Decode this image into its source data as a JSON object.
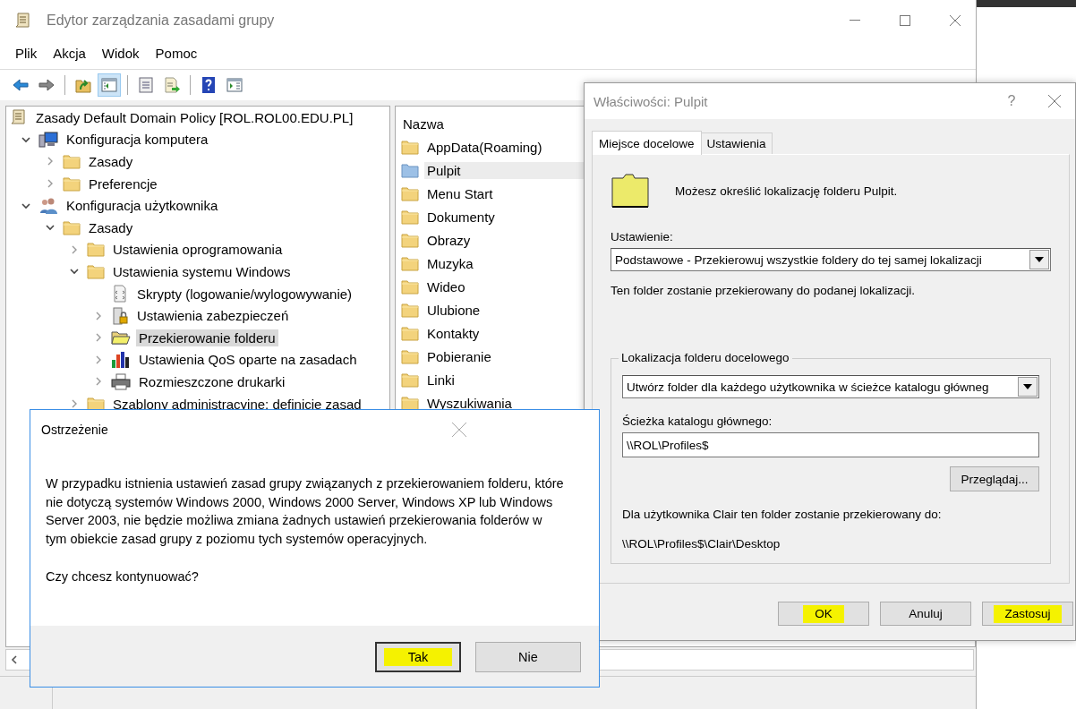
{
  "window": {
    "title": "Edytor zarządzania zasadami grupy"
  },
  "menu": [
    "Plik",
    "Akcja",
    "Widok",
    "Pomoc"
  ],
  "toolbar": [
    {
      "kind": "back",
      "pressed": false
    },
    {
      "kind": "forward",
      "pressed": false
    },
    {
      "kind": "separator"
    },
    {
      "kind": "up",
      "pressed": false
    },
    {
      "kind": "tree-toggle",
      "pressed": true
    },
    {
      "kind": "separator"
    },
    {
      "kind": "properties",
      "pressed": false
    },
    {
      "kind": "export",
      "pressed": false
    },
    {
      "kind": "separator"
    },
    {
      "kind": "help",
      "pressed": false
    },
    {
      "kind": "action-pane",
      "pressed": false
    }
  ],
  "tree": {
    "root": {
      "label": "Zasady Default Domain Policy [ROL.ROL00.EDU.PL]",
      "kind": "policy",
      "selected": false,
      "children": [
        {
          "label": "Konfiguracja komputera",
          "kind": "computer",
          "expandable": true,
          "expanded": true,
          "selected": false,
          "children": [
            {
              "label": "Zasady",
              "kind": "folder",
              "expandable": true,
              "expanded": false,
              "selected": false
            },
            {
              "label": "Preferencje",
              "kind": "folder",
              "expandable": true,
              "expanded": false,
              "selected": false
            }
          ]
        },
        {
          "label": "Konfiguracja użytkownika",
          "kind": "user",
          "expandable": true,
          "expanded": true,
          "selected": false,
          "children": [
            {
              "label": "Zasady",
              "kind": "folder",
              "expandable": true,
              "expanded": true,
              "selected": false,
              "children": [
                {
                  "label": "Ustawienia oprogramowania",
                  "kind": "folder",
                  "expandable": true,
                  "expanded": false,
                  "selected": false
                },
                {
                  "label": "Ustawienia systemu Windows",
                  "kind": "folder",
                  "expandable": true,
                  "expanded": true,
                  "selected": false,
                  "children": [
                    {
                      "label": "Skrypty (logowanie/wylogowywanie)",
                      "kind": "script",
                      "expandable": false,
                      "selected": false
                    },
                    {
                      "label": "Ustawienia zabezpieczeń",
                      "kind": "security",
                      "expandable": true,
                      "expanded": false,
                      "selected": false
                    },
                    {
                      "label": "Przekierowanie folderu",
                      "kind": "redirect",
                      "expandable": true,
                      "expanded": false,
                      "selected": true
                    },
                    {
                      "label": "Ustawienia QoS oparte na zasadach",
                      "kind": "qos",
                      "expandable": true,
                      "expanded": false,
                      "selected": false
                    },
                    {
                      "label": "Rozmieszczone drukarki",
                      "kind": "printer",
                      "expandable": true,
                      "expanded": false,
                      "selected": false
                    }
                  ]
                },
                {
                  "label": "Szablony administracyjne: definicje zasad",
                  "kind": "folder",
                  "expandable": true,
                  "expanded": false,
                  "selected": false
                }
              ]
            }
          ]
        }
      ]
    }
  },
  "list": {
    "header": "Nazwa",
    "items": [
      {
        "label": "AppData(Roaming)",
        "kind": "folder",
        "selected": false
      },
      {
        "label": "Pulpit",
        "kind": "redirected",
        "selected": true
      },
      {
        "label": "Menu Start",
        "kind": "folder",
        "selected": false
      },
      {
        "label": "Dokumenty",
        "kind": "folder",
        "selected": false
      },
      {
        "label": "Obrazy",
        "kind": "folder",
        "selected": false
      },
      {
        "label": "Muzyka",
        "kind": "folder",
        "selected": false
      },
      {
        "label": "Wideo",
        "kind": "folder",
        "selected": false
      },
      {
        "label": "Ulubione",
        "kind": "folder",
        "selected": false
      },
      {
        "label": "Kontakty",
        "kind": "folder",
        "selected": false
      },
      {
        "label": "Pobieranie",
        "kind": "folder",
        "selected": false
      },
      {
        "label": "Linki",
        "kind": "folder",
        "selected": false
      },
      {
        "label": "Wyszukiwania",
        "kind": "folder",
        "selected": false
      }
    ]
  },
  "properties": {
    "title": "Właściwości: Pulpit",
    "help": "?",
    "tabs": [
      {
        "label": "Miejsce docelowe",
        "selected": true
      },
      {
        "label": "Ustawienia",
        "selected": false
      }
    ],
    "intro": "Możesz określić lokalizację folderu Pulpit.",
    "setting_label": "Ustawienie:",
    "setting_value": "Podstawowe - Przekierowuj wszystkie foldery do tej samej lokalizacji",
    "setting_note": "Ten folder zostanie przekierowany do podanej lokalizacji.",
    "group": {
      "legend": "Lokalizacja folderu docelowego",
      "location_value": "Utwórz folder dla każdego użytkownika w ścieżce katalogu główneg",
      "path_label": "Ścieżka katalogu głównego:",
      "path_value": "\\\\ROL\\Profiles$",
      "browse_button": "Przeglądaj...",
      "result_label": "Dla użytkownika Clair ten folder zostanie przekierowany do:",
      "result_path": "\\\\ROL\\Profiles$\\Clair\\Desktop"
    },
    "buttons": [
      {
        "label": "OK",
        "highlighted": true
      },
      {
        "label": "Anuluj",
        "highlighted": false
      },
      {
        "label": "Zastosuj",
        "highlighted": true
      }
    ]
  },
  "warning": {
    "title": "Ostrzeżenie",
    "message": "W przypadku istnienia ustawień zasad grupy związanych z przekierowaniem folderu, które nie dotyczą systemów Windows 2000, Windows 2000 Server, Windows XP lub Windows Server 2003, nie będzie możliwa zmiana żadnych ustawień przekierowania folderów w tym obiekcie zasad grupy z poziomu tych systemów operacyjnych.",
    "question": "Czy chcesz kontynuować?",
    "buttons": [
      {
        "label": "Tak",
        "highlighted": true,
        "default": true
      },
      {
        "label": "Nie",
        "highlighted": false,
        "default": false
      }
    ]
  }
}
